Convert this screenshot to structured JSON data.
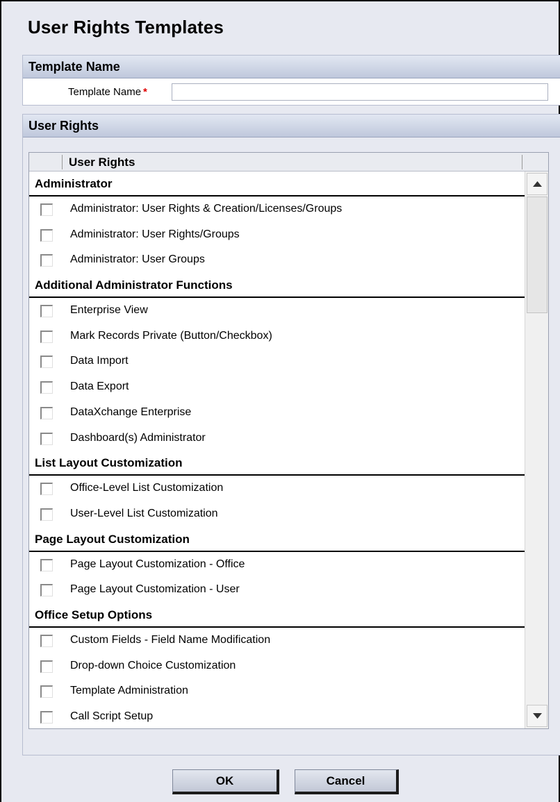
{
  "page": {
    "title": "User Rights Templates"
  },
  "template_section": {
    "header": "Template Name",
    "name_label": "Template Name",
    "required_mark": "*",
    "name_value": ""
  },
  "rights_section": {
    "header": "User Rights",
    "column_header": "User Rights",
    "groups": [
      {
        "title": "Administrator",
        "items": [
          {
            "label": "Administrator: User Rights & Creation/Licenses/Groups",
            "checked": false
          },
          {
            "label": "Administrator: User Rights/Groups",
            "checked": false
          },
          {
            "label": "Administrator: User Groups",
            "checked": false
          }
        ]
      },
      {
        "title": "Additional Administrator Functions",
        "items": [
          {
            "label": "Enterprise View",
            "checked": false
          },
          {
            "label": "Mark Records Private (Button/Checkbox)",
            "checked": false
          },
          {
            "label": "Data Import",
            "checked": false
          },
          {
            "label": "Data Export",
            "checked": false
          },
          {
            "label": "DataXchange Enterprise",
            "checked": false
          },
          {
            "label": "Dashboard(s) Administrator",
            "checked": false
          }
        ]
      },
      {
        "title": "List Layout Customization",
        "items": [
          {
            "label": "Office-Level List Customization",
            "checked": false
          },
          {
            "label": "User-Level List Customization",
            "checked": false
          }
        ]
      },
      {
        "title": "Page Layout Customization",
        "items": [
          {
            "label": "Page Layout Customization - Office",
            "checked": false
          },
          {
            "label": "Page Layout Customization - User",
            "checked": false
          }
        ]
      },
      {
        "title": "Office Setup Options",
        "items": [
          {
            "label": "Custom Fields - Field Name Modification",
            "checked": false
          },
          {
            "label": "Drop-down Choice Customization",
            "checked": false
          },
          {
            "label": "Template Administration",
            "checked": false
          },
          {
            "label": "Call Script Setup",
            "checked": false
          }
        ]
      }
    ]
  },
  "icons": {
    "scroll_up": "triangle-up-icon",
    "scroll_down": "triangle-down-icon"
  },
  "buttons": {
    "ok": "OK",
    "cancel": "Cancel"
  }
}
